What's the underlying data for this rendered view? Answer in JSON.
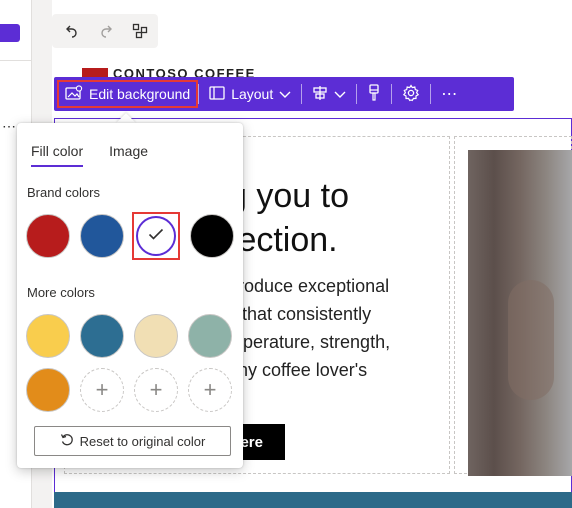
{
  "toolbar": {
    "edit_background": "Edit background",
    "layout": "Layout"
  },
  "logo": {
    "text": "CONTOSO COFFEE"
  },
  "hero": {
    "title": "g you to\nfection.",
    "body": "produce exceptional\ns that consistently\nmperature, strength,\n any coffee lover's",
    "button": "ere"
  },
  "popup": {
    "tabs": [
      "Fill color",
      "Image"
    ],
    "active_tab": "Fill color",
    "brand_colors_label": "Brand colors",
    "more_colors_label": "More colors",
    "brand_colors": [
      "#b71c1c",
      "#21579b",
      "#ffffff",
      "#000000"
    ],
    "selected_brand_index": 2,
    "more_colors": [
      "#f9cd4d",
      "#2d6e92",
      "#f1dfb4",
      "#8eb2a8",
      "#e28c1a"
    ],
    "reset_label": "Reset to original color"
  },
  "colors": {
    "accent": "#5c2dd5",
    "highlight": "#e53935"
  },
  "icons": [
    "undo-icon",
    "redo-icon",
    "link-icon",
    "edit-background-icon",
    "layout-icon",
    "align-icon",
    "brush-icon",
    "gear-icon",
    "more-icon",
    "check-icon",
    "plus-icon",
    "reset-icon"
  ]
}
